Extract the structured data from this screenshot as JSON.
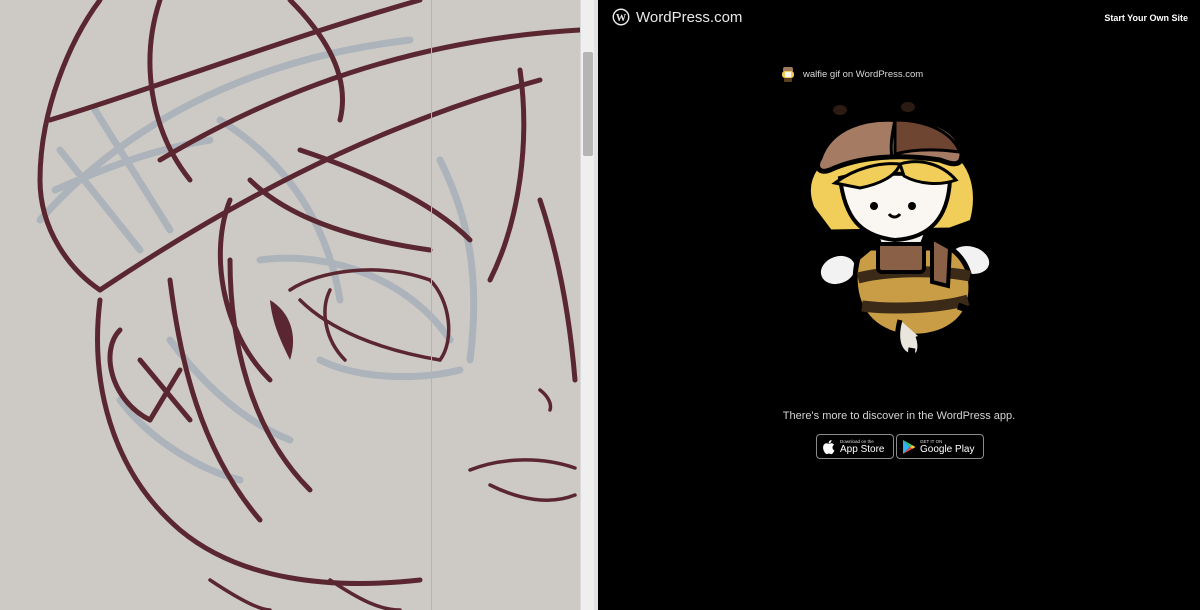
{
  "brand": {
    "name": "WordPress.com",
    "icon": "wordpress-icon"
  },
  "header": {
    "start_site": "Start Your Own Site"
  },
  "gif": {
    "source_label": "walfie gif on WordPress.com",
    "avatar_icon": "walfie-avatar-icon",
    "image_icon": "bee-character-gif"
  },
  "promo": {
    "text": "There's more to discover in the WordPress app."
  },
  "stores": {
    "app_store": {
      "small": "Download on the",
      "big": "App Store",
      "icon": "apple-icon"
    },
    "google_play": {
      "small": "GET IT ON",
      "big": "Google Play",
      "icon": "google-play-icon"
    }
  },
  "colors": {
    "canvas_bg": "#cdcac6",
    "line_art": "#5a2730",
    "sketch": "#a7b0b8",
    "page_bg": "#000000"
  }
}
